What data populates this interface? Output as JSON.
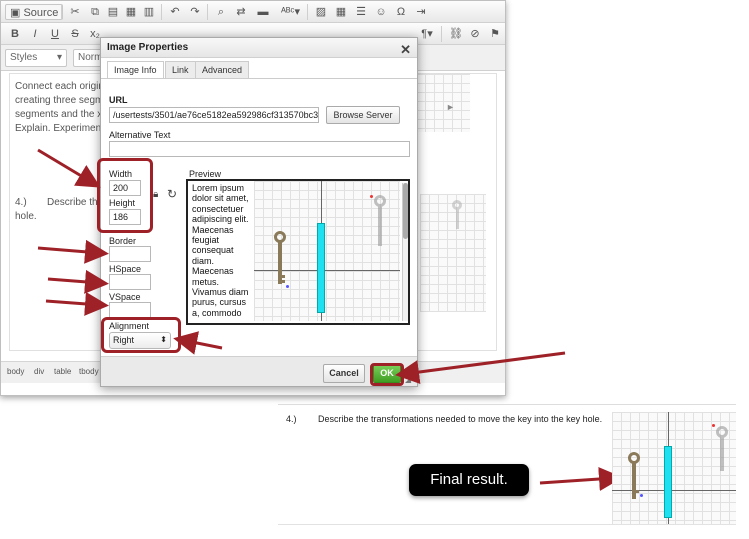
{
  "editor": {
    "toolbar": {
      "source_label": "Source",
      "styles_label": "Styles",
      "format_label": "Norm"
    },
    "content": {
      "para_lines": [
        "Connect each origina",
        "creating three segme",
        "segments and the x-",
        "Explain. Experiment"
      ],
      "question_num": "4.)",
      "question_text": "Describe the",
      "question_tail": "hole."
    },
    "status_path": [
      "body",
      "div",
      "table",
      "tbody"
    ]
  },
  "dialog": {
    "title": "Image Properties",
    "close_label": "✕",
    "tabs": [
      "Image Info",
      "Link",
      "Advanced"
    ],
    "active_tab": "Image Info",
    "url_label": "URL",
    "url_value": "/usertests/3501/ae76ce5182ea592986cf313570bc35",
    "browse_label": "Browse Server",
    "alt_label": "Alternative Text",
    "alt_value": "",
    "width_label": "Width",
    "width_value": "200",
    "height_label": "Height",
    "height_value": "186",
    "border_label": "Border",
    "hspace_label": "HSpace",
    "vspace_label": "VSpace",
    "alignment_label": "Alignment",
    "alignment_value": "Right",
    "preview_label": "Preview",
    "preview_text": "Lorem ipsum dolor sit amet, consectetuer adipiscing elit. Maecenas feugiat consequat diam. Maecenas metus. Vivamus diam purus, cursus a, commodo",
    "cancel_label": "Cancel",
    "ok_label": "OK"
  },
  "final": {
    "question_num": "4.)",
    "question_text": "Describe the transformations needed to move the key into the key hole.",
    "callout": "Final result."
  },
  "colors": {
    "highlight": "#9e2128",
    "ok_green": "#4caf2a",
    "bar_cyan": "#1fe0f0"
  }
}
